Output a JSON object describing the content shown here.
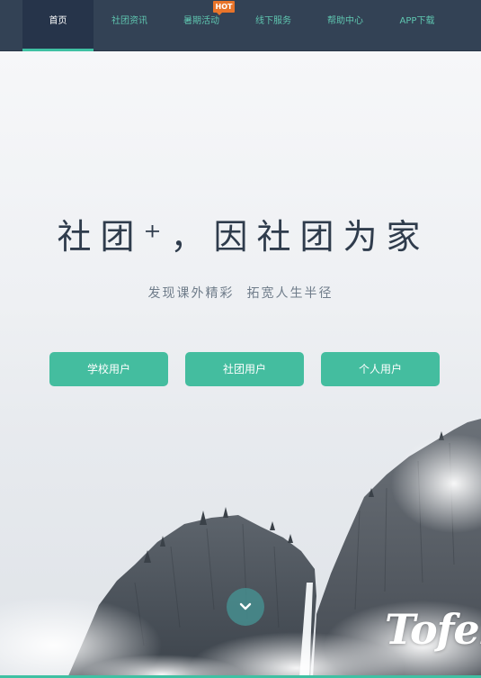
{
  "nav": {
    "items": [
      {
        "label": "首页",
        "active": true
      },
      {
        "label": "社团资讯",
        "active": false
      },
      {
        "label": "暑期活动",
        "active": false
      },
      {
        "label": "线下服务",
        "active": false
      },
      {
        "label": "帮助中心",
        "active": false
      },
      {
        "label": "APP下载",
        "active": false
      }
    ],
    "hot_badge": "HOT"
  },
  "hero": {
    "headline": "社团⁺，因社团为家",
    "subline_left": "发现课外精彩",
    "subline_right": "拓宽人生半径",
    "buttons": {
      "school": "学校用户",
      "club": "社团用户",
      "personal": "个人用户"
    },
    "logo_text": "Tofei",
    "scroll_icon": "chevron-down-icon"
  },
  "colors": {
    "nav_bg": "#334255",
    "nav_text": "#5fc6b0",
    "accent": "#44bd9f",
    "hot": "#e8742a",
    "headline": "#2f3c4c"
  }
}
